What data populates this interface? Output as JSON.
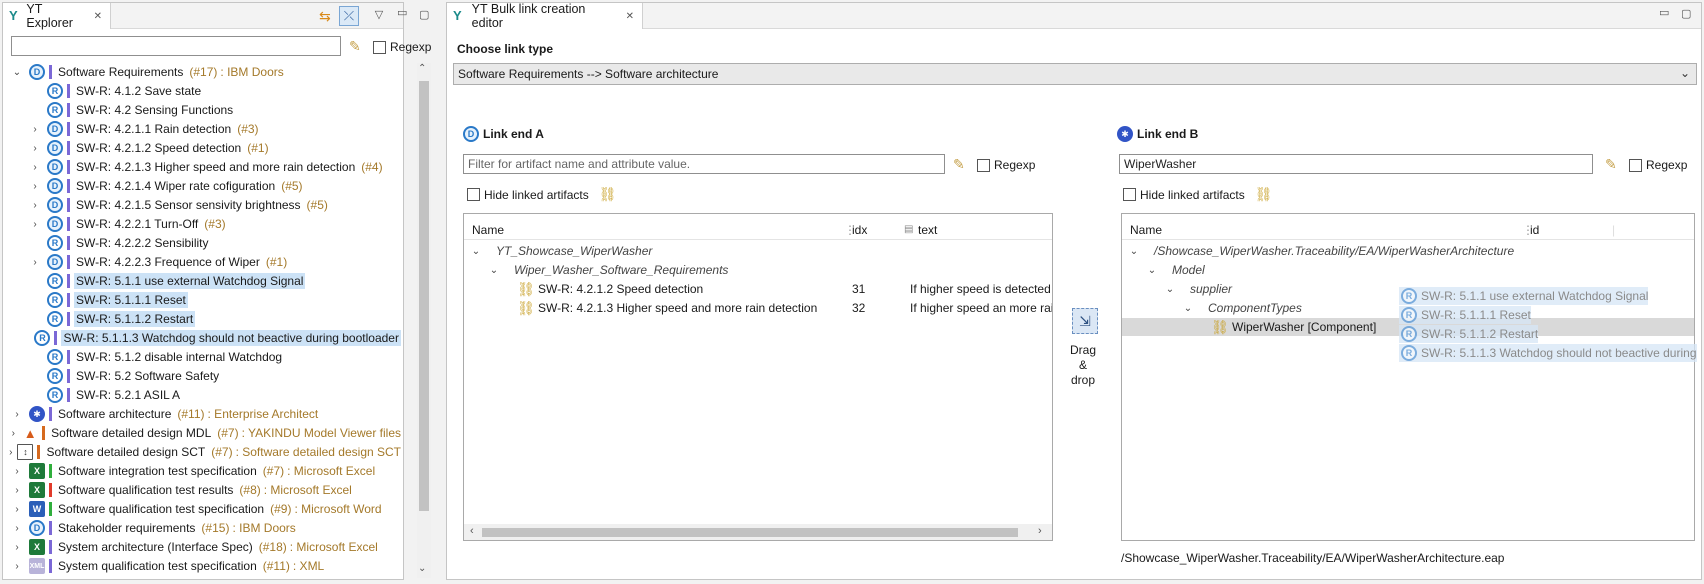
{
  "explorer": {
    "tab_title": "YT Explorer",
    "regexp_label": "Regexp",
    "filter_value": "",
    "items": [
      {
        "label": "Software Requirements",
        "count": "(#17)",
        "source": ": IBM Doors",
        "icon": "doors-icon",
        "bar": "#7b68d6",
        "level": 0,
        "arrow": "⌄"
      },
      {
        "label": "SW-R: 4.1.2 Save state",
        "icon": "requirement-icon",
        "bar": "#7b68d6",
        "level": 1,
        "arrow": ""
      },
      {
        "label": "SW-R: 4.2 Sensing Functions",
        "icon": "requirement-icon",
        "bar": "#7b68d6",
        "level": 1,
        "arrow": ""
      },
      {
        "label": "SW-R: 4.2.1.1 Rain detection",
        "count": "(#3)",
        "icon": "doors-icon",
        "bar": "#7b68d6",
        "level": 1,
        "arrow": "›"
      },
      {
        "label": "SW-R: 4.2.1.2 Speed detection",
        "count": "(#1)",
        "icon": "doors-icon",
        "bar": "#7b68d6",
        "level": 1,
        "arrow": "›"
      },
      {
        "label": "SW-R: 4.2.1.3 Higher speed and more rain detection",
        "count": "(#4)",
        "icon": "doors-icon",
        "bar": "#7b68d6",
        "level": 1,
        "arrow": "›"
      },
      {
        "label": "SW-R: 4.2.1.4 Wiper rate cofiguration",
        "count": "(#5)",
        "icon": "doors-icon",
        "bar": "#7b68d6",
        "level": 1,
        "arrow": "›"
      },
      {
        "label": "SW-R: 4.2.1.5 Sensor sensivity brightness",
        "count": "(#5)",
        "icon": "doors-icon",
        "bar": "#7b68d6",
        "level": 1,
        "arrow": "›"
      },
      {
        "label": "SW-R: 4.2.2.1 Turn-Off",
        "count": "(#3)",
        "icon": "doors-icon",
        "bar": "#7b68d6",
        "level": 1,
        "arrow": "›"
      },
      {
        "label": "SW-R: 4.2.2.2 Sensibility",
        "icon": "requirement-icon",
        "bar": "#7b68d6",
        "level": 1,
        "arrow": ""
      },
      {
        "label": "SW-R: 4.2.2.3 Frequence of Wiper",
        "count": "(#1)",
        "icon": "doors-icon",
        "bar": "#7b68d6",
        "level": 1,
        "arrow": "›"
      },
      {
        "label": "SW-R: 5.1.1 use external Watchdog Signal",
        "icon": "requirement-icon",
        "bar": "#7b68d6",
        "level": 1,
        "arrow": "",
        "selected": true
      },
      {
        "label": "SW-R: 5.1.1.1 Reset",
        "icon": "requirement-icon",
        "bar": "#7b68d6",
        "level": 1,
        "arrow": "",
        "selected": true
      },
      {
        "label": "SW-R: 5.1.1.2 Restart",
        "icon": "requirement-icon",
        "bar": "#7b68d6",
        "level": 1,
        "arrow": "",
        "selected": true
      },
      {
        "label": "SW-R: 5.1.1.3 Watchdog should not beactive during bootloader",
        "icon": "requirement-icon",
        "bar": "#7b68d6",
        "level": 1,
        "arrow": "",
        "selected": true
      },
      {
        "label": "SW-R: 5.1.2 disable internal Watchdog",
        "icon": "requirement-icon",
        "bar": "#7b68d6",
        "level": 1,
        "arrow": ""
      },
      {
        "label": "SW-R: 5.2 Software Safety",
        "icon": "requirement-icon",
        "bar": "#7b68d6",
        "level": 1,
        "arrow": ""
      },
      {
        "label": "SW-R: 5.2.1 ASIL A",
        "icon": "requirement-icon",
        "bar": "#7b68d6",
        "level": 1,
        "arrow": ""
      },
      {
        "label": "Software architecture",
        "count": "(#11)",
        "source": ": Enterprise Architect",
        "icon": "enterprise-architect-icon",
        "bar": "#7b68d6",
        "level": 0,
        "arrow": "›"
      },
      {
        "label": "Software detailed design MDL",
        "count": "(#7)",
        "source": ": YAKINDU Model Viewer files",
        "icon": "matlab-icon",
        "bar": "#d66a1e",
        "level": 0,
        "arrow": "›"
      },
      {
        "label": "Software detailed design SCT",
        "count": "(#7)",
        "source": ": Software detailed design SCT",
        "icon": "statechart-icon",
        "bar": "#d66a1e",
        "level": 0,
        "arrow": "›"
      },
      {
        "label": "Software integration test specification",
        "count": "(#7)",
        "source": ": Microsoft Excel",
        "icon": "excel-icon",
        "bar": "#2fae3c",
        "level": 0,
        "arrow": "›"
      },
      {
        "label": "Software qualification test results",
        "count": "(#8)",
        "source": ": Microsoft Excel",
        "icon": "excel-icon",
        "bar": "#e03a2a",
        "level": 0,
        "arrow": "›"
      },
      {
        "label": "Software qualification test specification",
        "count": "(#9)",
        "source": ": Microsoft Word",
        "icon": "word-icon",
        "bar": "#2fae3c",
        "level": 0,
        "arrow": "›"
      },
      {
        "label": "Stakeholder requirements",
        "count": "(#15)",
        "source": ": IBM Doors",
        "icon": "doors-icon",
        "bar": "#7b68d6",
        "level": 0,
        "arrow": "›"
      },
      {
        "label": "System architecture (Interface Spec)",
        "count": "(#18)",
        "source": ": Microsoft Excel",
        "icon": "excel-icon",
        "bar": "#7b68d6",
        "level": 0,
        "arrow": "›"
      },
      {
        "label": "System qualification test specification",
        "count": "(#11)",
        "source": ": XML",
        "icon": "xml-icon",
        "bar": "#7b68d6",
        "level": 0,
        "arrow": "›"
      }
    ]
  },
  "editor": {
    "tab_title": "YT Bulk link creation editor",
    "choose_label": "Choose link type",
    "link_type": "Software Requirements --> Software architecture",
    "end_a": {
      "title": "Link end A",
      "filter_placeholder": "Filter for artifact name and attribute value.",
      "regexp_label": "Regexp",
      "hide_label": "Hide linked artifacts",
      "columns": {
        "name": "Name",
        "idx": "idx",
        "text": "text"
      },
      "rows": [
        {
          "name": "YT_Showcase_WiperWasher",
          "idx": "",
          "text": "",
          "level": 0,
          "italic": true,
          "arrow": "⌄"
        },
        {
          "name": "Wiper_Washer_Software_Requirements",
          "idx": "",
          "text": "",
          "level": 1,
          "italic": true,
          "arrow": "⌄"
        },
        {
          "name": "SW-R: 4.2.1.2 Speed detection",
          "idx": "31",
          "text": "If higher speed is detected v",
          "level": 2,
          "italic": false,
          "arrow": ""
        },
        {
          "name": "SW-R: 4.2.1.3 Higher speed and more rain detection",
          "idx": "32",
          "text": "If higher speed an more rain",
          "level": 2,
          "italic": false,
          "arrow": ""
        }
      ]
    },
    "drag": {
      "line1": "Drag",
      "line2": "&",
      "line3": "drop"
    },
    "end_b": {
      "title": "Link end B",
      "filter_value": "WiperWasher",
      "regexp_label": "Regexp",
      "hide_label": "Hide linked artifacts",
      "columns": {
        "name": "Name",
        "id": "id"
      },
      "rows": [
        {
          "name": "/Showcase_WiperWasher.Traceability/EA/WiperWasherArchitecture",
          "level": 0,
          "arrow": "⌄"
        },
        {
          "name": "Model",
          "level": 1,
          "arrow": "⌄"
        },
        {
          "name": "supplier",
          "level": 2,
          "arrow": "⌄"
        },
        {
          "name": "ComponentTypes",
          "level": 3,
          "arrow": "⌄"
        },
        {
          "name": "WiperWasher [Component]",
          "level": 4,
          "arrow": ""
        }
      ],
      "ghost_items": [
        "SW-R: 5.1.1 use external Watchdog Signal",
        "SW-R: 5.1.1.1 Reset",
        "SW-R: 5.1.1.2 Restart",
        "SW-R: 5.1.1.3 Watchdog should not beactive during"
      ],
      "path": "/Showcase_WiperWasher.Traceability/EA/WiperWasherArchitecture.eap"
    }
  }
}
